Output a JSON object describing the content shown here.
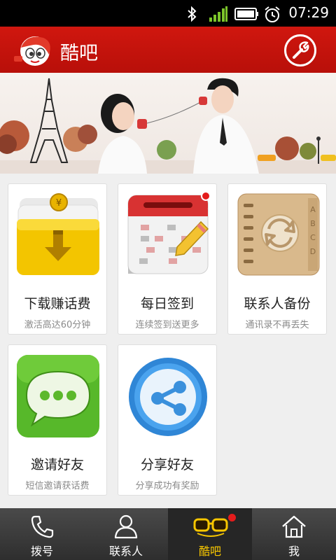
{
  "status_bar": {
    "time": "07:29",
    "icons": [
      "bluetooth-icon",
      "signal-icon",
      "battery-icon",
      "alarm-icon"
    ]
  },
  "header": {
    "title": "酷吧",
    "logo": "mascot-logo",
    "right_icon": "wrench-icon"
  },
  "banner": {
    "image": "couple-string-telephone-paris-banner"
  },
  "features": [
    {
      "title": "下载赚话费",
      "subtitle": "激活高达60分钟",
      "icon": "download-coins-icon",
      "badge": false
    },
    {
      "title": "每日签到",
      "subtitle": "连续签到送更多",
      "icon": "calendar-pencil-icon",
      "badge": true
    },
    {
      "title": "联系人备份",
      "subtitle": "通讯录不再丢失",
      "icon": "contact-backup-icon",
      "badge": false
    },
    {
      "title": "邀请好友",
      "subtitle": "短信邀请获话费",
      "icon": "sms-bubble-icon",
      "badge": false
    },
    {
      "title": "分享好友",
      "subtitle": "分享成功有奖励",
      "icon": "share-icon",
      "badge": false
    }
  ],
  "bottom_nav": {
    "active_index": 2,
    "items": [
      {
        "label": "拨号",
        "icon": "phone-icon"
      },
      {
        "label": "联系人",
        "icon": "person-icon"
      },
      {
        "label": "酷吧",
        "icon": "glasses-icon",
        "badge": true
      },
      {
        "label": "我",
        "icon": "home-icon"
      }
    ]
  },
  "colors": {
    "header_red": "#c9140d",
    "active_nav_label": "#f7c600",
    "badge_red": "#e41c1c"
  }
}
